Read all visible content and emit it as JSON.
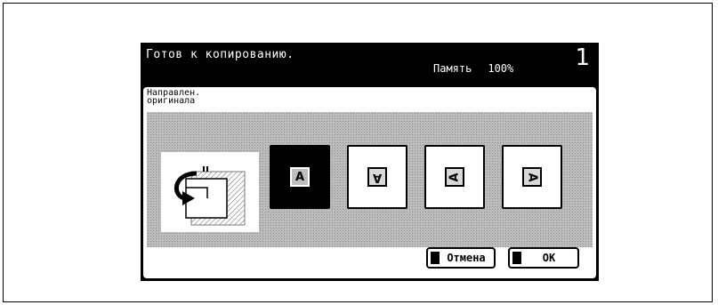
{
  "header": {
    "title": "Готов к копированию.",
    "memory_label": "Память",
    "memory_value": "100%",
    "job_number": "1"
  },
  "section": {
    "label_line1": "Направлен.",
    "label_line2": "оригинала"
  },
  "orientation": {
    "options": [
      {
        "glyph": "A",
        "icon": "orientation-upright-icon",
        "selected": true
      },
      {
        "glyph": "A",
        "icon": "orientation-upside-down-icon",
        "selected": false
      },
      {
        "glyph": "A",
        "icon": "orientation-left-icon",
        "selected": false
      },
      {
        "glyph": "A",
        "icon": "orientation-right-icon",
        "selected": false
      }
    ]
  },
  "buttons": {
    "cancel_label": "Отмена",
    "ok_label": "OK"
  }
}
